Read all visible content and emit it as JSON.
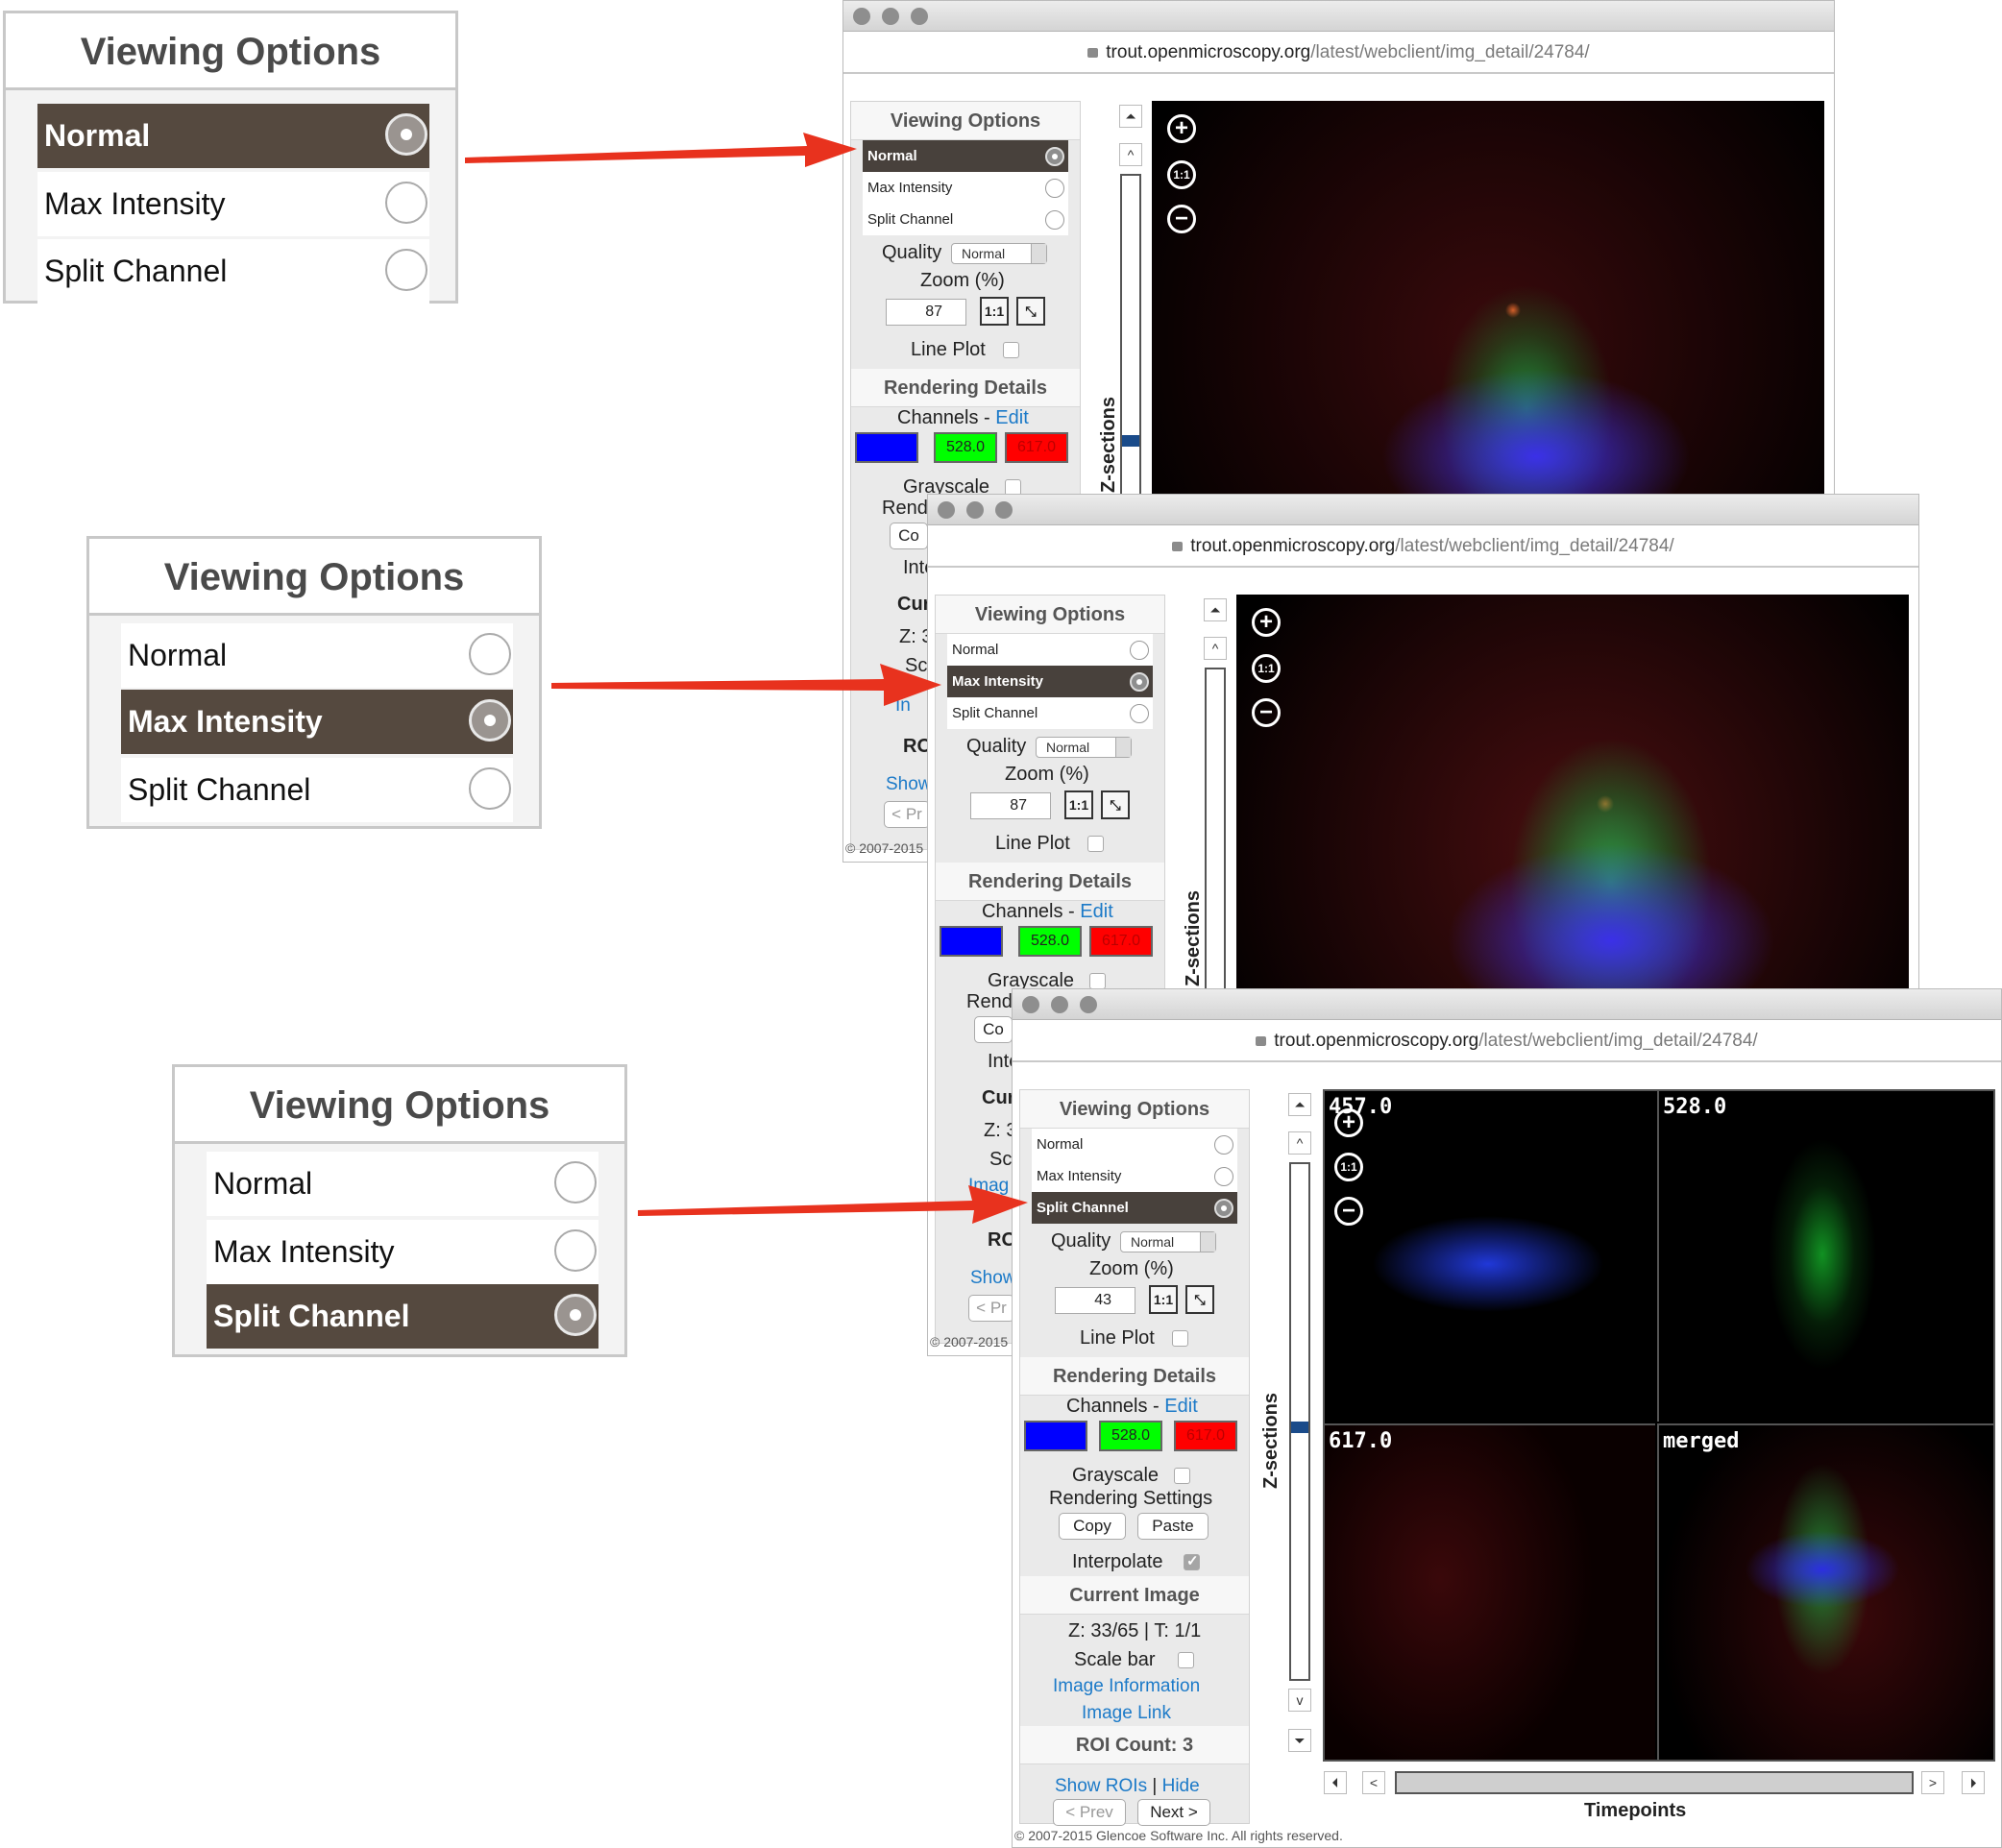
{
  "callouts": {
    "title": "Viewing Options",
    "options": [
      "Normal",
      "Max Intensity",
      "Split Channel"
    ],
    "selected": [
      "Normal",
      "Max Intensity",
      "Split Channel"
    ]
  },
  "browser": {
    "url_host": "trout.openmicroscopy.org",
    "url_path": "/latest/webclient/img_detail/24784/"
  },
  "panel": {
    "viewing_options_title": "Viewing Options",
    "options": [
      "Normal",
      "Max Intensity",
      "Split Channel"
    ],
    "quality_label": "Quality",
    "quality_value": "Normal",
    "zoom_label": "Zoom (%)",
    "zoom_values": [
      "87",
      "87",
      "43"
    ],
    "zoom_btn_1": "1:1",
    "line_plot_label": "Line Plot",
    "rendering_details_title": "Rendering Details",
    "channels_label": "Channels - ",
    "channels_edit": "Edit",
    "channels": [
      {
        "label": "457.0",
        "color": "#0000ff"
      },
      {
        "label": "528.0",
        "color": "#00ff00"
      },
      {
        "label": "617.0",
        "color": "#ff0000"
      }
    ],
    "grayscale_label": "Grayscale",
    "rendering_settings_label": "Rendering Settings",
    "copy_label": "Copy",
    "paste_label": "Paste",
    "interpolate_label": "Interpolate",
    "current_image_title": "Current Image",
    "zt_info": "Z: 33/65 | T: 1/1",
    "scale_bar_label": "Scale bar",
    "image_information": "Image Information",
    "image_link": "Image Link",
    "roi_count": "ROI Count: 3",
    "show_rois": "Show ROIs",
    "separator": "|",
    "hide": "Hide",
    "prev": "< Prev",
    "next": "Next >",
    "footer": "© 2007-2015 Glencoe Software Inc. All rights reserved.",
    "footer_short": "© 2007-2015"
  },
  "partial": {
    "rend": "Rend",
    "cop": "Co",
    "inte": "Inte",
    "cur": "Cur",
    "z": "Z: 3",
    "sc": "Sc",
    "img": "Imag",
    "in": "In",
    "ro": "RO",
    "show": "Show",
    "prev": "< Pr"
  },
  "viewer": {
    "z_sections_label": "Z-sections",
    "timepoints_label": "Timepoints",
    "zoom_in": "+",
    "zoom_1to1": "1:1",
    "zoom_out": "−",
    "split_labels": [
      "457.0",
      "528.0",
      "617.0",
      "merged"
    ]
  },
  "colors": {
    "selected_bg": "#55493f",
    "link": "#1c7ac8",
    "arrow": "#e8321e"
  }
}
